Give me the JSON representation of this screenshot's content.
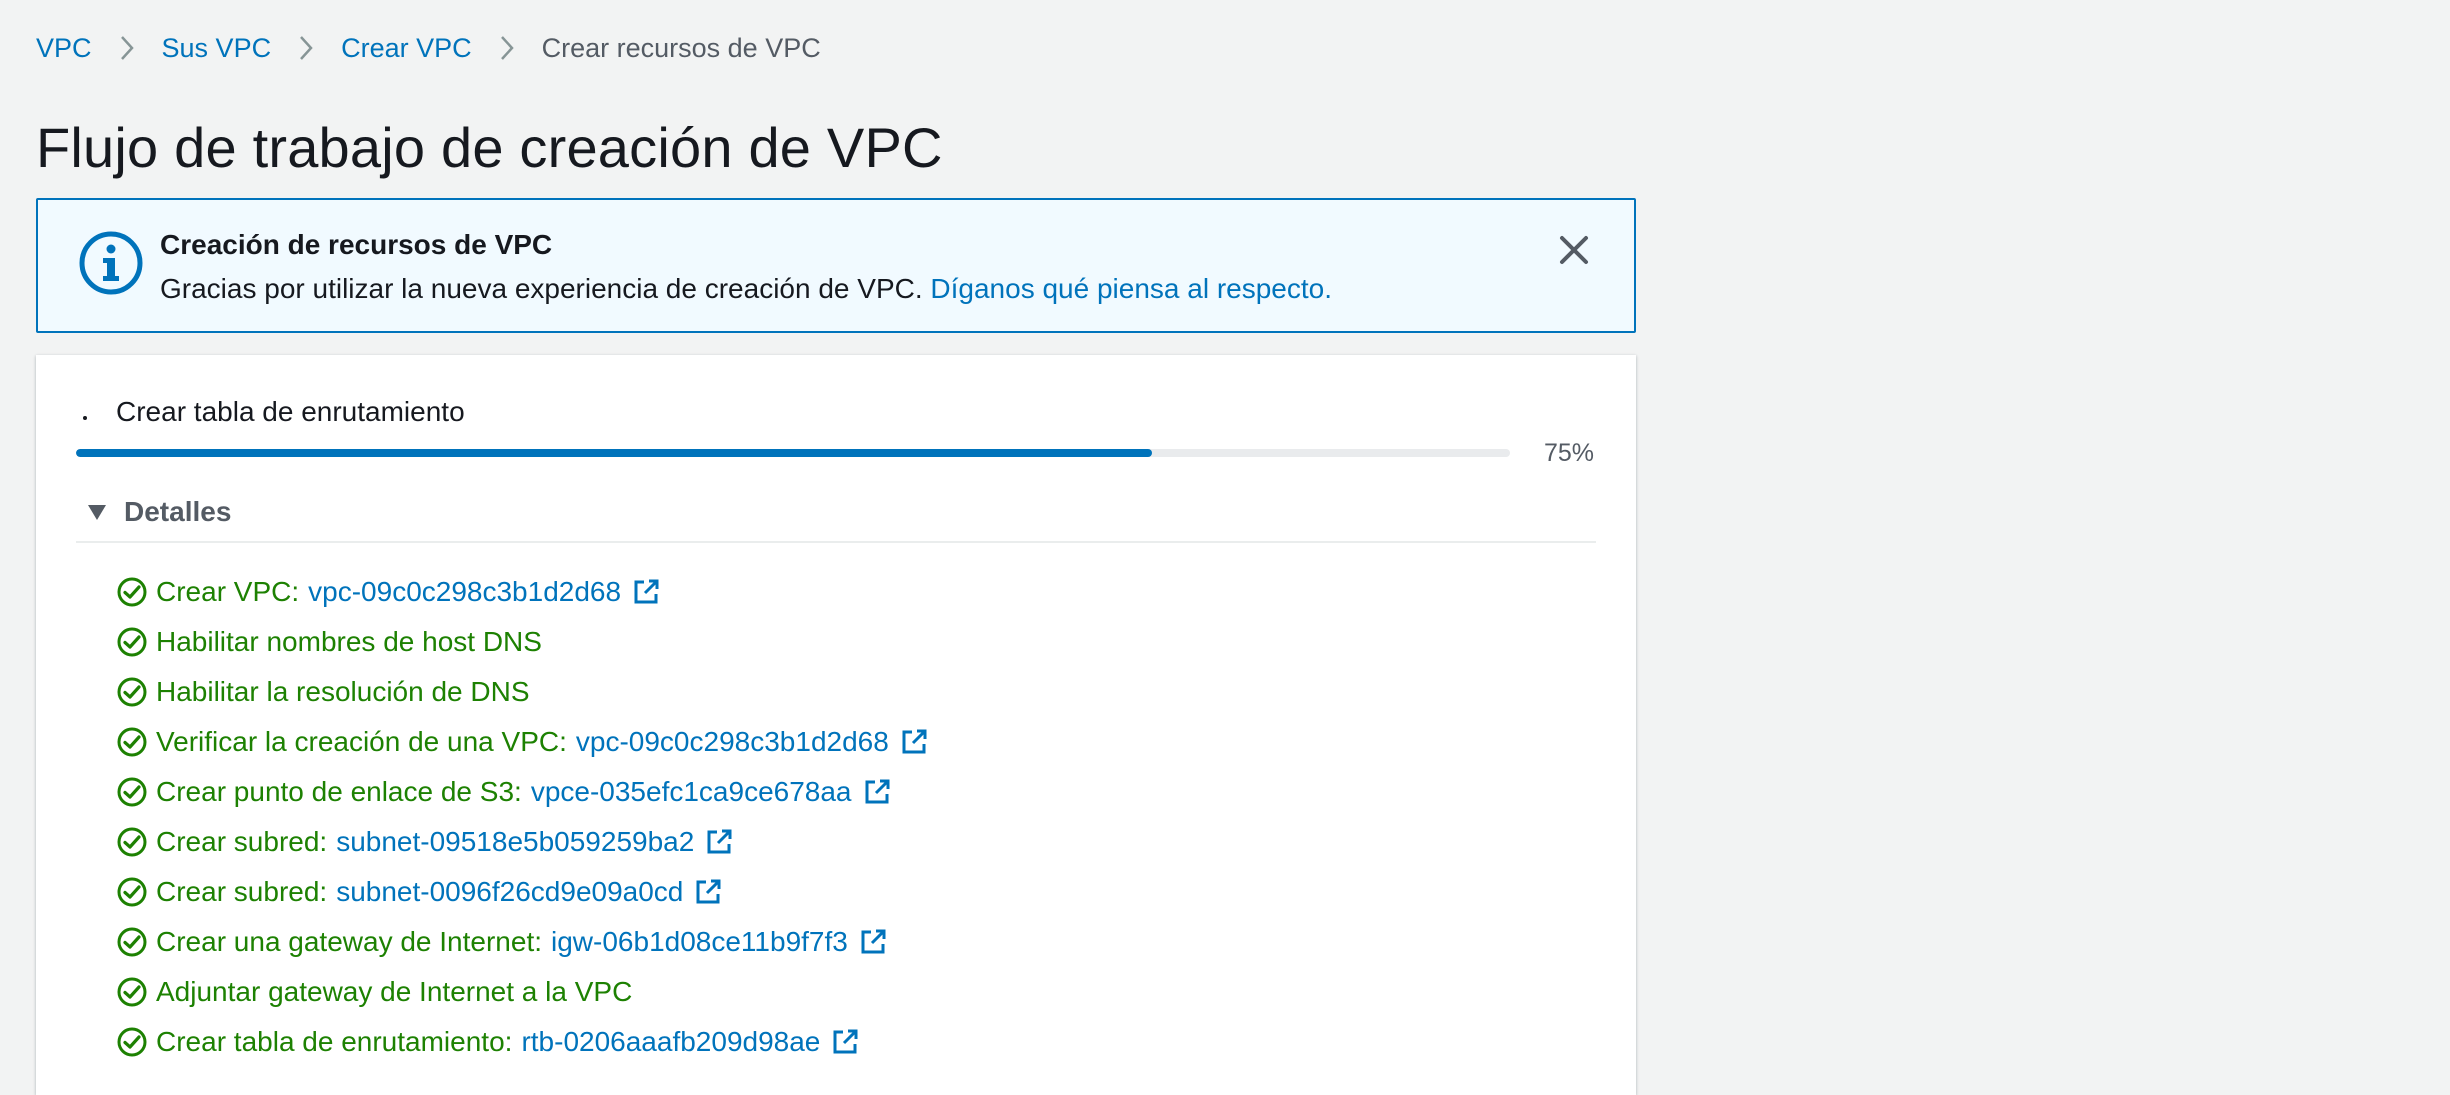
{
  "breadcrumb": {
    "items": [
      "VPC",
      "Sus VPC",
      "Crear VPC"
    ],
    "current": "Crear recursos de VPC"
  },
  "page": {
    "title": "Flujo de trabajo de creación de VPC"
  },
  "alert": {
    "title": "Creación de recursos de VPC",
    "body": "Gracias por utilizar la nueva experiencia de creación de VPC.",
    "link": "Díganos qué piensa al respecto.",
    "icon": "info-icon"
  },
  "progress": {
    "current_step": "Crear tabla de enrutamiento",
    "percent_label": "75%",
    "fraction": 0.75
  },
  "details": {
    "title": "Detalles",
    "steps": [
      {
        "label": "Crear VPC:",
        "resource": "vpc-09c0c298c3b1d2d68"
      },
      {
        "label": "Habilitar nombres de host DNS",
        "resource": null
      },
      {
        "label": "Habilitar la resolución de DNS",
        "resource": null
      },
      {
        "label": "Verificar la creación de una VPC:",
        "resource": "vpc-09c0c298c3b1d2d68"
      },
      {
        "label": "Crear punto de enlace de S3:",
        "resource": "vpce-035efc1ca9ce678aa"
      },
      {
        "label": "Crear subred:",
        "resource": "subnet-09518e5b059259ba2"
      },
      {
        "label": "Crear subred:",
        "resource": "subnet-0096f26cd9e09a0cd"
      },
      {
        "label": "Crear una gateway de Internet:",
        "resource": "igw-06b1d08ce11b9f7f3"
      },
      {
        "label": "Adjuntar gateway de Internet a la VPC",
        "resource": null
      },
      {
        "label": "Crear tabla de enrutamiento:",
        "resource": "rtb-0206aaafb209d98ae"
      }
    ]
  },
  "colors": {
    "link": "#0073bb",
    "success": "#1d8102",
    "alert_bg": "#f1faff",
    "page_bg": "#f2f3f3"
  }
}
